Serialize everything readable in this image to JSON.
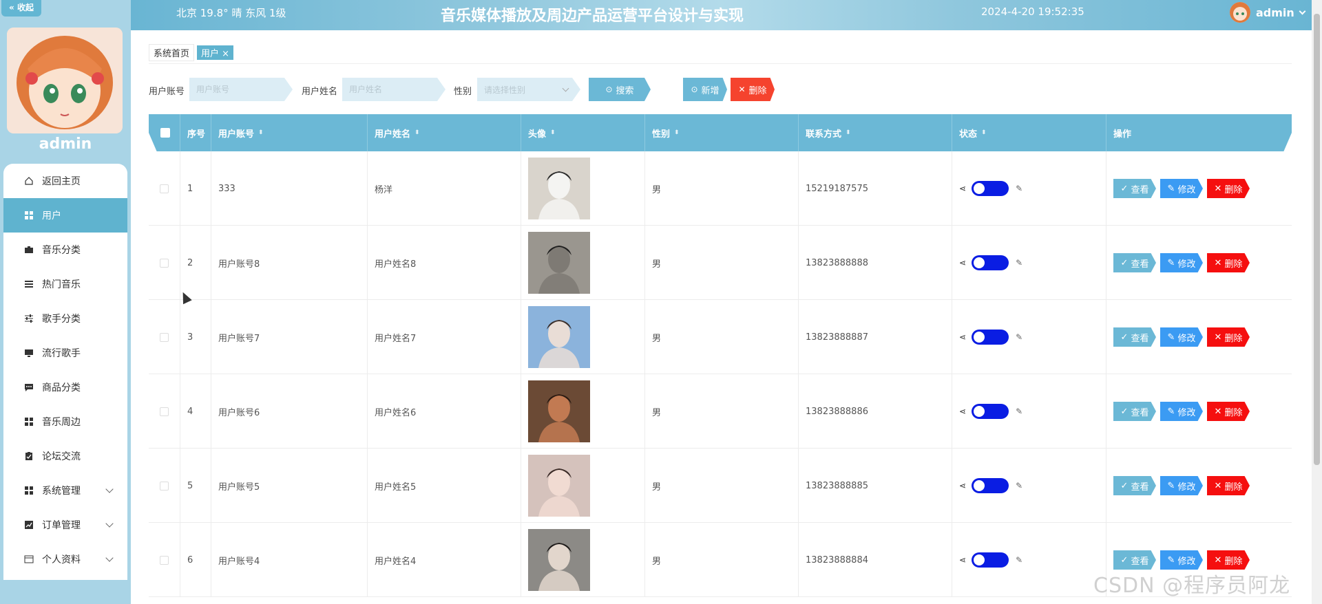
{
  "sidebar": {
    "collapse_label": "« 收起",
    "username": "admin",
    "items": [
      {
        "label": "返回主页",
        "icon": "home-icon",
        "active": false
      },
      {
        "label": "用户",
        "icon": "grid-icon",
        "active": true
      },
      {
        "label": "音乐分类",
        "icon": "briefcase-icon",
        "active": false
      },
      {
        "label": "热门音乐",
        "icon": "list-icon",
        "active": false
      },
      {
        "label": "歌手分类",
        "icon": "sliders-icon",
        "active": false
      },
      {
        "label": "流行歌手",
        "icon": "monitor-icon",
        "active": false
      },
      {
        "label": "商品分类",
        "icon": "chat-icon",
        "active": false
      },
      {
        "label": "音乐周边",
        "icon": "grid-icon",
        "active": false
      },
      {
        "label": "论坛交流",
        "icon": "clipboard-icon",
        "active": false
      },
      {
        "label": "系统管理",
        "icon": "grid-icon",
        "active": false,
        "expandable": true
      },
      {
        "label": "订单管理",
        "icon": "chart-icon",
        "active": false,
        "expandable": true
      },
      {
        "label": "个人资料",
        "icon": "card-icon",
        "active": false,
        "expandable": true
      }
    ]
  },
  "header": {
    "weather": "北京  19.8°  晴  东风  1级",
    "title": "音乐媒体播放及周边产品运营平台设计与实现",
    "datetime": "2024-4-20 19:52:35",
    "username": "admin"
  },
  "breadcrumb": {
    "home": "系统首页",
    "current": "用户",
    "close": "×"
  },
  "search": {
    "account_label": "用户账号",
    "account_placeholder": "用户账号",
    "name_label": "用户姓名",
    "name_placeholder": "用户姓名",
    "gender_label": "性别",
    "gender_placeholder": "请选择性别",
    "search_button": "搜索",
    "add_button": "新增",
    "delete_button": "删除"
  },
  "table": {
    "columns": [
      "序号",
      "用户账号",
      "用户姓名",
      "头像",
      "性别",
      "联系方式",
      "状态",
      "操作"
    ],
    "rows": [
      {
        "index": "1",
        "account": "333",
        "name": "杨洋",
        "gender": "男",
        "phone": "15219187575"
      },
      {
        "index": "2",
        "account": "用户账号8",
        "name": "用户姓名8",
        "gender": "男",
        "phone": "13823888888"
      },
      {
        "index": "3",
        "account": "用户账号7",
        "name": "用户姓名7",
        "gender": "男",
        "phone": "13823888887"
      },
      {
        "index": "4",
        "account": "用户账号6",
        "name": "用户姓名6",
        "gender": "男",
        "phone": "13823888886"
      },
      {
        "index": "5",
        "account": "用户账号5",
        "name": "用户姓名5",
        "gender": "男",
        "phone": "13823888885"
      },
      {
        "index": "6",
        "account": "用户账号4",
        "name": "用户姓名4",
        "gender": "男",
        "phone": "13823888884"
      }
    ],
    "actions": {
      "view": "查看",
      "edit": "修改",
      "delete": "删除"
    }
  },
  "watermark": "CSDN @程序员阿龙",
  "colors": {
    "accent": "#6bb8d6",
    "sidebar_bg": "#a9d4e6",
    "danger": "#f5432e",
    "edit": "#3b9bf3",
    "toggle": "#0a1de3"
  }
}
